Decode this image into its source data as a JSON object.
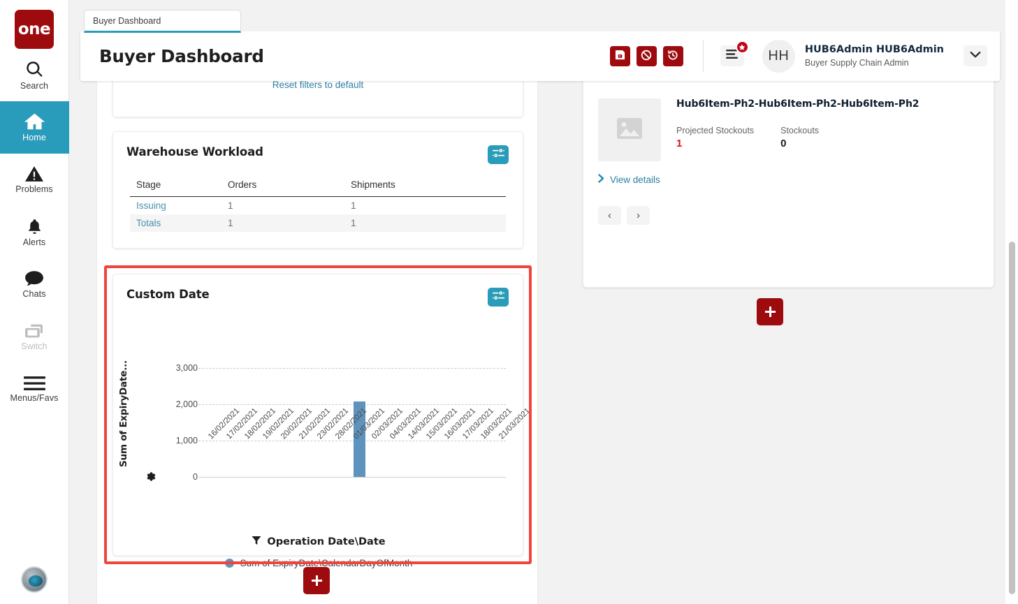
{
  "tab": {
    "label": "Buyer Dashboard"
  },
  "header": {
    "title": "Buyer Dashboard",
    "actions": [
      {
        "name": "save",
        "icon": "save-icon"
      },
      {
        "name": "cancel",
        "icon": "cancel-icon"
      },
      {
        "name": "revert",
        "icon": "history-icon"
      }
    ],
    "menus_icon": "menus-favs-icon",
    "badge_icon": "star-badge-icon",
    "avatar_initials": "HH",
    "user_name": "HUB6Admin HUB6Admin",
    "user_role": "Buyer Supply Chain Admin",
    "chevron_icon": "chevron-down-icon"
  },
  "sidebar": {
    "logo": "one",
    "items": [
      {
        "label": "Search",
        "icon": "search-icon",
        "state": "normal"
      },
      {
        "label": "Home",
        "icon": "home-icon",
        "state": "active"
      },
      {
        "label": "Problems",
        "icon": "problems-icon",
        "state": "normal"
      },
      {
        "label": "Alerts",
        "icon": "bell-icon",
        "state": "normal"
      },
      {
        "label": "Chats",
        "icon": "chat-icon",
        "state": "normal"
      },
      {
        "label": "Switch",
        "icon": "switch-icon",
        "state": "muted"
      },
      {
        "label": "Menus/Favs",
        "icon": "hamburger-icon",
        "state": "normal"
      }
    ]
  },
  "filters_card": {
    "reset_label": "Reset filters to default"
  },
  "warehouse_workload": {
    "title": "Warehouse Workload",
    "config_icon": "sliders-icon",
    "columns": [
      "Stage",
      "Orders",
      "Shipments"
    ],
    "rows": [
      {
        "stage": "Issuing",
        "orders": "1",
        "shipments": "1"
      },
      {
        "stage": "Totals",
        "orders": "1",
        "shipments": "1"
      }
    ]
  },
  "custom_date": {
    "title": "Custom Date",
    "config_icon": "sliders-icon",
    "axis_gear_icon": "gear-icon",
    "filter_icon": "funnel-icon"
  },
  "chart_data": {
    "type": "bar",
    "title": "Custom Date",
    "xlabel": "Operation Date\\Date",
    "ylabel": "Sum of ExpiryDate...",
    "ylim": [
      0,
      3000
    ],
    "yticks": [
      "0",
      "1,000",
      "2,000",
      "3,000"
    ],
    "ytick_values": [
      0,
      1000,
      2000,
      3000
    ],
    "grid": true,
    "legend_position": "bottom",
    "series": [
      {
        "name": "Sum of ExpiryDate\\CalendarDayOfMonth",
        "color": "#5e93bd",
        "values": [
          0,
          0,
          0,
          0,
          0,
          0,
          0,
          0,
          2070,
          0,
          0,
          0,
          0,
          0,
          0,
          0,
          0
        ]
      }
    ],
    "categories": [
      "16/02/2021",
      "17/02/2021",
      "18/02/2021",
      "19/02/2021",
      "20/02/2021",
      "21/02/2021",
      "23/02/2021",
      "28/02/2021",
      "01/03/2021",
      "02/03/2021",
      "04/03/2021",
      "14/03/2021",
      "15/03/2021",
      "16/03/2021",
      "17/03/2021",
      "18/03/2021",
      "21/03/2021"
    ]
  },
  "items_card": {
    "items": [
      {
        "name": "",
        "thumb_icon": "image-placeholder-icon",
        "stats": [
          {
            "label": "Projected Stockouts",
            "value": "1",
            "emphasis": "red"
          },
          {
            "label": "Stockouts",
            "value": "0",
            "emphasis": "dark"
          }
        ],
        "link": "View details",
        "link_icon": "chevron-right-icon"
      },
      {
        "name": "Hub6Item-Ph2-Hub6Item-Ph2-Hub6Item-Ph2",
        "thumb_icon": "image-placeholder-icon",
        "stats": [
          {
            "label": "Projected Stockouts",
            "value": "1",
            "emphasis": "red"
          },
          {
            "label": "Stockouts",
            "value": "0",
            "emphasis": "dark"
          }
        ],
        "link": "View details",
        "link_icon": "chevron-right-icon"
      }
    ],
    "pager": {
      "prev": "‹",
      "next": "›"
    }
  },
  "add_widget": {
    "label": "+",
    "icon": "plus-icon"
  },
  "colors": {
    "brand_red": "#9e0b0f",
    "accent_teal": "#2a9cbb",
    "bar_blue": "#5e93bd",
    "highlight_red": "#f0443e",
    "link_blue": "#2c7fa3",
    "stat_red": "#d41313"
  }
}
